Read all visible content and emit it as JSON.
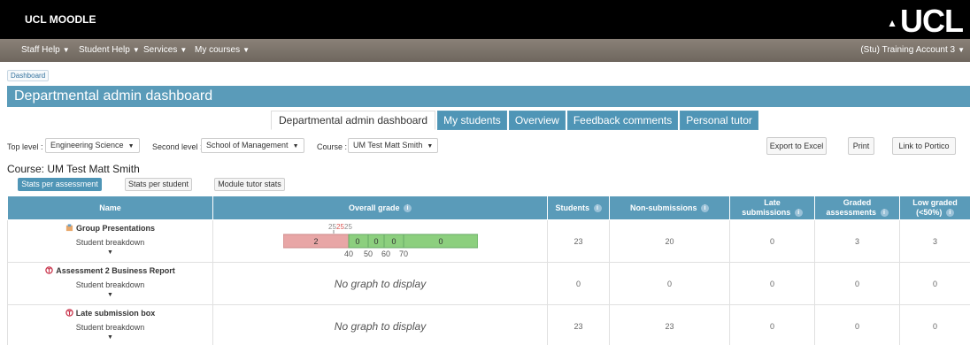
{
  "header": {
    "brand": "UCL MOODLE",
    "logo": "UCL",
    "logo_icon": "ucl-portico-icon"
  },
  "nav": {
    "items": [
      "Staff Help",
      "Student Help",
      "Services",
      "My courses"
    ],
    "user": "(Stu) Training Account 3"
  },
  "breadcrumb": "Dashboard",
  "page_title": "Departmental admin dashboard",
  "tabs": [
    {
      "label": "Departmental admin dashboard",
      "active": true
    },
    {
      "label": "My students",
      "active": false
    },
    {
      "label": "Overview",
      "active": false
    },
    {
      "label": "Feedback comments",
      "active": false
    },
    {
      "label": "Personal tutor",
      "active": false
    }
  ],
  "filters": {
    "top_level_label": "Top level :",
    "top_level_value": "Engineering Science",
    "second_level_label": "Second level :",
    "second_level_value": "School of Management",
    "course_label": "Course :",
    "course_value": "UM Test Matt Smith"
  },
  "actions": {
    "export": "Export to Excel",
    "print": "Print",
    "portico": "Link to Portico"
  },
  "course_title": "Course: UM Test Matt Smith",
  "view_buttons": {
    "per_assessment": "Stats per assessment",
    "per_student": "Stats per student",
    "module_tutor": "Module tutor stats"
  },
  "table": {
    "headers": {
      "name": "Name",
      "grade": "Overall grade",
      "students": "Students",
      "nonsub": "Non-submissions",
      "late_1": "Late",
      "late_2": "submissions",
      "graded_1": "Graded",
      "graded_2": "assessments",
      "low_1": "Low graded",
      "low_2": "(<50%)"
    },
    "student_breakdown": "Student breakdown",
    "no_graph": "No graph to display",
    "rows": [
      {
        "name": "Group Presentations",
        "icon": "assignment-icon",
        "students": "23",
        "nonsub": "20",
        "late": "0",
        "graded": "3",
        "low": "3"
      },
      {
        "name": "Assessment 2 Business Report",
        "icon": "turnitin-icon",
        "students": "0",
        "nonsub": "0",
        "late": "0",
        "graded": "0",
        "low": "0"
      },
      {
        "name": "Late submission box",
        "icon": "turnitin-icon",
        "students": "23",
        "nonsub": "23",
        "late": "0",
        "graded": "0",
        "low": "0"
      }
    ]
  },
  "grade_chart": {
    "top_labels": [
      "25",
      "25",
      "25"
    ],
    "top_label_colors": [
      "#888888",
      "#d9534f",
      "#888888"
    ],
    "band_counts": [
      "2",
      "0",
      "0",
      "0",
      "0"
    ],
    "band_colors": [
      "#e8a6a6",
      "#8ccf7e",
      "#8ccf7e",
      "#8ccf7e",
      "#8ccf7e"
    ],
    "axis_ticks": [
      "40",
      "50",
      "60",
      "70"
    ]
  },
  "colors": {
    "accent": "#5a9bb9",
    "nav": "#7c746b"
  }
}
